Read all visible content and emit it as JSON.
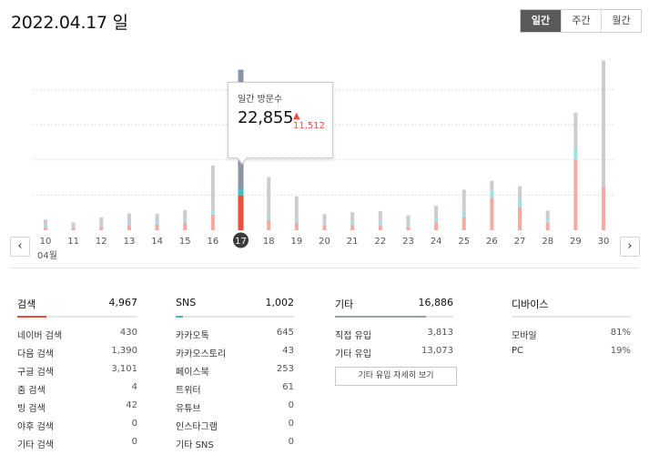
{
  "date_title": "2022.04.17 일",
  "period_tabs": [
    "일간",
    "주간",
    "월간"
  ],
  "active_period": "일간",
  "tooltip": {
    "label": "일간 방문수",
    "value": "22,855",
    "change": "▲ 11,512"
  },
  "colors": {
    "search": "#e9503b",
    "sns": "#3fbfc3",
    "etc": "#c9cdd1",
    "selected_etc": "#8c93a6",
    "search_light": "#f3aaa0",
    "sns_light": "#9fdfe0"
  },
  "chart_data": {
    "type": "bar",
    "stacked": true,
    "categories": [
      "10",
      "11",
      "12",
      "13",
      "14",
      "15",
      "16",
      "17",
      "18",
      "19",
      "20",
      "21",
      "22",
      "23",
      "24",
      "25",
      "26",
      "27",
      "28",
      "29",
      "30"
    ],
    "month_label": "04월",
    "selected_category": "17",
    "series": [
      {
        "values": [
          430,
          320,
          560,
          650,
          780,
          1040,
          2220,
          4967,
          1520,
          1090,
          650,
          740,
          690,
          550,
          1140,
          1820,
          4620,
          3280,
          1070,
          9970,
          6160
        ]
      },
      {
        "values": [
          220,
          170,
          240,
          300,
          300,
          330,
          460,
          1002,
          470,
          340,
          170,
          330,
          330,
          300,
          490,
          790,
          1120,
          1150,
          320,
          1680,
          0
        ]
      },
      {
        "values": [
          860,
          600,
          1010,
          1430,
          1280,
          1520,
          6520,
          16886,
          5570,
          3400,
          1470,
          1480,
          1710,
          1260,
          1840,
          3160,
          1300,
          1830,
          1400,
          5110,
          17980
        ]
      }
    ],
    "ylim": [
      0,
      25000
    ],
    "gridlines": [
      5000,
      10000,
      15000,
      20000
    ]
  },
  "panels": [
    {
      "title": "검색",
      "total": "4,967",
      "highlight_color": "#e9503b",
      "rows": [
        {
          "label": "네이버 검색",
          "value": "430"
        },
        {
          "label": "다음 검색",
          "value": "1,390"
        },
        {
          "label": "구글 검색",
          "value": "3,101"
        },
        {
          "label": "줌 검색",
          "value": "4"
        },
        {
          "label": "빙 검색",
          "value": "42"
        },
        {
          "label": "야후 검색",
          "value": "0"
        },
        {
          "label": "기타 검색",
          "value": "0"
        }
      ]
    },
    {
      "title": "SNS",
      "total": "1,002",
      "highlight_color": "#3fbfc3",
      "rows": [
        {
          "label": "카카오톡",
          "value": "645"
        },
        {
          "label": "카카오스토리",
          "value": "43"
        },
        {
          "label": "페이스북",
          "value": "253"
        },
        {
          "label": "트위터",
          "value": "61"
        },
        {
          "label": "유튜브",
          "value": "0"
        },
        {
          "label": "인스타그램",
          "value": "0"
        },
        {
          "label": "기타 SNS",
          "value": "0"
        }
      ]
    },
    {
      "title": "기타",
      "total": "16,886",
      "highlight_color": "#9ba0ab",
      "rows": [
        {
          "label": "직접 유입",
          "value": "3,813"
        },
        {
          "label": "기타 유입",
          "value": "13,073"
        }
      ],
      "button_label": "기타 유입 자세히 보기"
    },
    {
      "title": "디바이스",
      "total": "",
      "highlight_color": "#e6e6e6",
      "rows": [
        {
          "label": "모바일",
          "value": "81%"
        },
        {
          "label": "PC",
          "value": "19%"
        }
      ]
    }
  ],
  "nav": {
    "prev_icon": "chevron-left-icon",
    "next_icon": "chevron-right-icon"
  }
}
